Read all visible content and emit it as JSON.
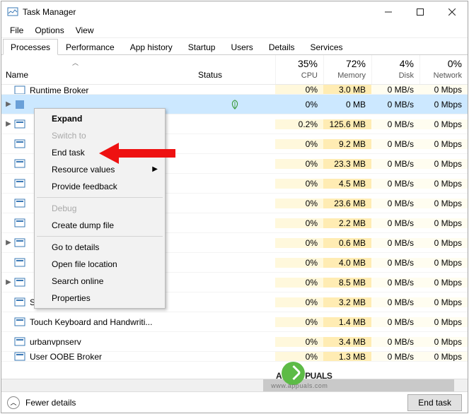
{
  "window": {
    "title": "Task Manager"
  },
  "menubar": [
    "File",
    "Options",
    "View"
  ],
  "tabs": [
    "Processes",
    "Performance",
    "App history",
    "Startup",
    "Users",
    "Details",
    "Services"
  ],
  "header": {
    "name": "Name",
    "status": "Status",
    "cols": [
      {
        "pct": "35%",
        "label": "CPU"
      },
      {
        "pct": "72%",
        "label": "Memory"
      },
      {
        "pct": "4%",
        "label": "Disk"
      },
      {
        "pct": "0%",
        "label": "Network"
      }
    ]
  },
  "halfrow": {
    "name": "Runtime Broker",
    "cpu": "0%",
    "mem": "3.0 MB",
    "disk": "0 MB/s",
    "net": "0 Mbps"
  },
  "selrow": {
    "cpu": "0%",
    "mem": "0 MB",
    "disk": "0 MB/s",
    "net": "0 Mbps",
    "leaf_color": "#3a9a3a"
  },
  "rows": [
    {
      "expand": true,
      "name": "",
      "cpu": "0.2%",
      "mem": "125.6 MB",
      "disk": "0 MB/s",
      "net": "0 Mbps"
    },
    {
      "expand": false,
      "name": "",
      "cpu": "0%",
      "mem": "9.2 MB",
      "disk": "0 MB/s",
      "net": "0 Mbps"
    },
    {
      "expand": false,
      "name": "",
      "cpu": "0%",
      "mem": "23.3 MB",
      "disk": "0 MB/s",
      "net": "0 Mbps"
    },
    {
      "expand": false,
      "name": "",
      "cpu": "0%",
      "mem": "4.5 MB",
      "disk": "0 MB/s",
      "net": "0 Mbps"
    },
    {
      "expand": false,
      "name": "",
      "cpu": "0%",
      "mem": "23.6 MB",
      "disk": "0 MB/s",
      "net": "0 Mbps"
    },
    {
      "expand": false,
      "name": "",
      "cpu": "0%",
      "mem": "2.2 MB",
      "disk": "0 MB/s",
      "net": "0 Mbps"
    },
    {
      "expand": true,
      "name": "",
      "cpu": "0%",
      "mem": "0.6 MB",
      "disk": "0 MB/s",
      "net": "0 Mbps"
    },
    {
      "expand": false,
      "name": "",
      "cpu": "0%",
      "mem": "4.0 MB",
      "disk": "0 MB/s",
      "net": "0 Mbps"
    },
    {
      "expand": true,
      "name": "",
      "cpu": "0%",
      "mem": "8.5 MB",
      "disk": "0 MB/s",
      "net": "0 Mbps"
    },
    {
      "expand": false,
      "name": "System Guard Runtime Monitor...",
      "cpu": "0%",
      "mem": "3.2 MB",
      "disk": "0 MB/s",
      "net": "0 Mbps"
    },
    {
      "expand": false,
      "name": "Touch Keyboard and Handwriti...",
      "cpu": "0%",
      "mem": "1.4 MB",
      "disk": "0 MB/s",
      "net": "0 Mbps"
    },
    {
      "expand": false,
      "name": "urbanvpnserv",
      "cpu": "0%",
      "mem": "3.4 MB",
      "disk": "0 MB/s",
      "net": "0 Mbps"
    },
    {
      "expand": false,
      "name": "User OOBE Broker",
      "cpu": "0%",
      "mem": "1.3 MB",
      "disk": "0 MB/s",
      "net": "0 Mbps",
      "half": true
    }
  ],
  "context_menu": [
    {
      "label": "Expand",
      "bold": true
    },
    {
      "label": "Switch to",
      "disabled": true
    },
    {
      "label": "End task"
    },
    {
      "label": "Resource values",
      "submenu": true
    },
    {
      "label": "Provide feedback"
    },
    {
      "sep": true
    },
    {
      "label": "Debug",
      "disabled": true
    },
    {
      "label": "Create dump file"
    },
    {
      "sep": true
    },
    {
      "label": "Go to details"
    },
    {
      "label": "Open file location"
    },
    {
      "label": "Search online"
    },
    {
      "label": "Properties"
    }
  ],
  "footer": {
    "fewer": "Fewer details",
    "endtask": "End task"
  },
  "watermark": {
    "brand": "A   PUALS",
    "sub": "www.appuals.com"
  }
}
